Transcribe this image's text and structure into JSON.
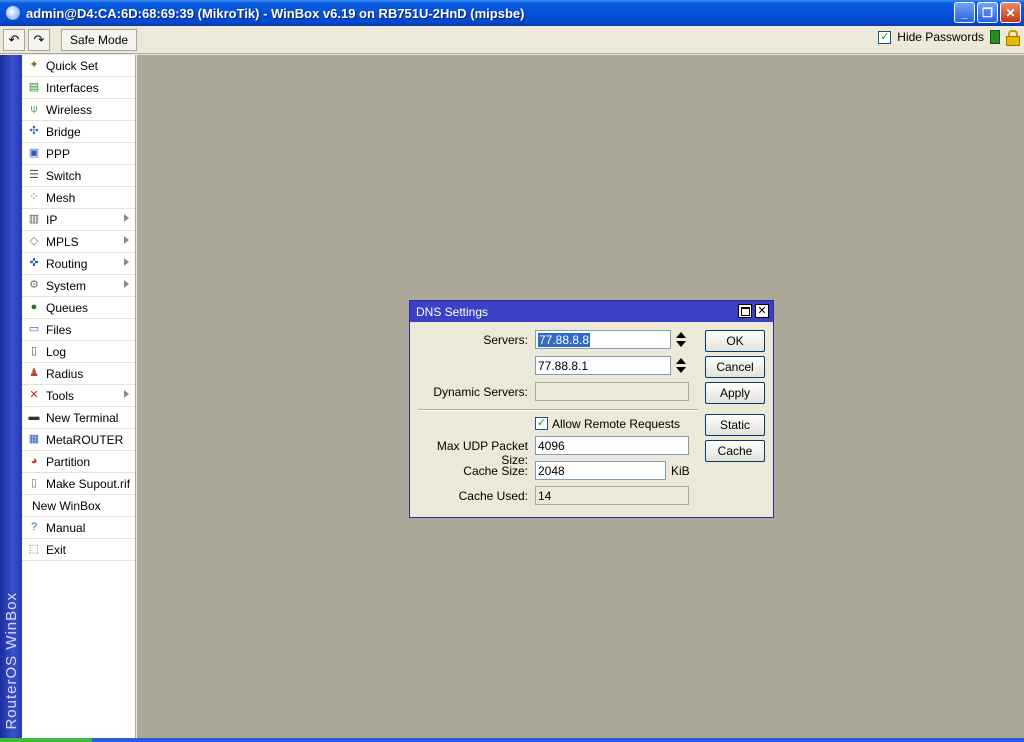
{
  "window": {
    "title": "admin@D4:CA:6D:68:69:39 (MikroTik) - WinBox v6.19 on RB751U-2HnD (mipsbe)",
    "minimize": "_",
    "maximize": "❐",
    "close": "✕"
  },
  "toolbar": {
    "undo": "↶",
    "redo": "↷",
    "safe_mode": "Safe Mode",
    "hide_passwords_label": "Hide Passwords",
    "hide_passwords_checked": "✓"
  },
  "brand": "RouterOS WinBox",
  "menu": {
    "items": [
      {
        "label": "Quick Set",
        "icon": "✦",
        "color": "#8a6a1f"
      },
      {
        "label": "Interfaces",
        "icon": "▤",
        "color": "#2f8a2f"
      },
      {
        "label": "Wireless",
        "icon": "⍦",
        "color": "#2f8a2f"
      },
      {
        "label": "Bridge",
        "icon": "✣",
        "color": "#2a5fb5"
      },
      {
        "label": "PPP",
        "icon": "▣",
        "color": "#2a5fb5"
      },
      {
        "label": "Switch",
        "icon": "☰",
        "color": "#555555"
      },
      {
        "label": "Mesh",
        "icon": "⁘",
        "color": "#555555"
      },
      {
        "label": "IP",
        "icon": "▥",
        "color": "#555555",
        "submenu": true
      },
      {
        "label": "MPLS",
        "icon": "◇",
        "color": "#777777",
        "submenu": true
      },
      {
        "label": "Routing",
        "icon": "✜",
        "color": "#2a5fb5",
        "submenu": true
      },
      {
        "label": "System",
        "icon": "⚙",
        "color": "#777777",
        "submenu": true
      },
      {
        "label": "Queues",
        "icon": "●",
        "color": "#2f6a2f"
      },
      {
        "label": "Files",
        "icon": "▭",
        "color": "#2a5fb5"
      },
      {
        "label": "Log",
        "icon": "▯",
        "color": "#555555"
      },
      {
        "label": "Radius",
        "icon": "♟",
        "color": "#b54a2a"
      },
      {
        "label": "Tools",
        "icon": "✕",
        "color": "#b52a2a",
        "submenu": true
      },
      {
        "label": "New Terminal",
        "icon": "▬",
        "color": "#333333"
      },
      {
        "label": "MetaROUTER",
        "icon": "▦",
        "color": "#2a5fb5"
      },
      {
        "label": "Partition",
        "icon": "◕",
        "color": "#c0392b"
      },
      {
        "label": "Make Supout.rif",
        "icon": "▯",
        "color": "#777777"
      },
      {
        "label": "New WinBox",
        "icon": "",
        "color": "#000000"
      },
      {
        "label": "Manual",
        "icon": "?",
        "color": "#2a5fb5"
      },
      {
        "label": "Exit",
        "icon": "⬚",
        "color": "#8a5a1f"
      }
    ]
  },
  "dialog": {
    "title": "DNS Settings",
    "close": "✕",
    "servers_label": "Servers:",
    "server1": "77.88.8.8",
    "server2": "77.88.8.1",
    "dynamic_servers_label": "Dynamic Servers:",
    "dynamic_servers": "",
    "allow_remote_label": "Allow Remote Requests",
    "allow_remote_checked": "✓",
    "max_udp_label": "Max UDP Packet Size:",
    "max_udp": "4096",
    "cache_size_label": "Cache Size:",
    "cache_size": "2048",
    "cache_size_unit": "KiB",
    "cache_used_label": "Cache Used:",
    "cache_used": "14",
    "buttons": {
      "ok": "OK",
      "cancel": "Cancel",
      "apply": "Apply",
      "static": "Static",
      "cache": "Cache"
    }
  }
}
